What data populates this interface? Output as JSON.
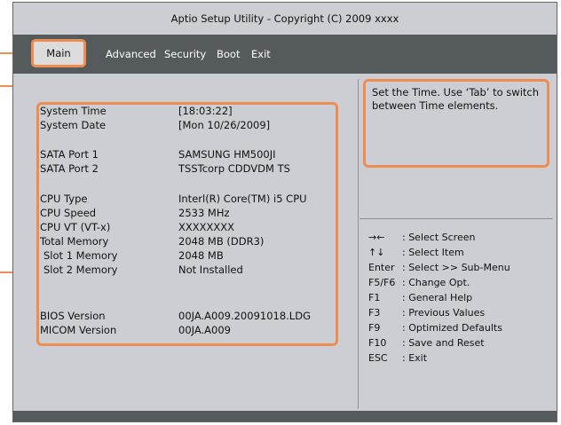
{
  "title": "Aptio Setup Utility - Copyright (C) 2009 xxxx",
  "menu": {
    "main": "Main",
    "advanced": "Advanced",
    "security": "Security",
    "boot": "Boot",
    "exit": "Exit"
  },
  "fields": {
    "system_time": {
      "label": "System Time",
      "value": "[18:03:22]"
    },
    "system_date": {
      "label": "System Date",
      "value": "[Mon 10/26/2009]"
    },
    "sata1": {
      "label": "SATA Port 1",
      "value": "SAMSUNG HM500JI"
    },
    "sata2": {
      "label": "SATA Port 2",
      "value": "TSSTcorp CDDVDM TS"
    },
    "cpu_type": {
      "label": "CPU Type",
      "value": "Interl(R) Core(TM) i5 CPU"
    },
    "cpu_speed": {
      "label": "CPU Speed",
      "value": "2533 MHz"
    },
    "cpu_vt": {
      "label": "CPU VT (VT-x)",
      "value": "XXXXXXXX"
    },
    "total_memory": {
      "label": "Total Memory",
      "value": "2048 MB (DDR3)"
    },
    "slot1": {
      "label": "Slot 1 Memory",
      "value": "2048 MB"
    },
    "slot2": {
      "label": "Slot 2 Memory",
      "value": "Not Installed"
    },
    "bios": {
      "label": "BIOS Version",
      "value": "00JA.A009.20091018.LDG"
    },
    "micom": {
      "label": "MICOM Version",
      "value": "00JA.A009"
    }
  },
  "help_text": "Set the Time. Use ‘Tab’ to switch between Time elements.",
  "keys": [
    {
      "key": "→←",
      "desc": ": Select Screen"
    },
    {
      "key": "↑↓",
      "desc": ": Select Item"
    },
    {
      "key": "Enter",
      "desc": ": Select >> Sub-Menu"
    },
    {
      "key": "F5/F6",
      "desc": ": Change Opt."
    },
    {
      "key": "F1",
      "desc": ": General Help"
    },
    {
      "key": "F3",
      "desc": ": Previous Values"
    },
    {
      "key": "F9",
      "desc": ": Optimized Defaults"
    },
    {
      "key": "F10",
      "desc": ": Save and Reset"
    },
    {
      "key": "ESC",
      "desc": ": Exit"
    }
  ],
  "colors": {
    "highlight": "#ee8d52",
    "menubar": "#555a5c",
    "background": "#ccced4"
  }
}
